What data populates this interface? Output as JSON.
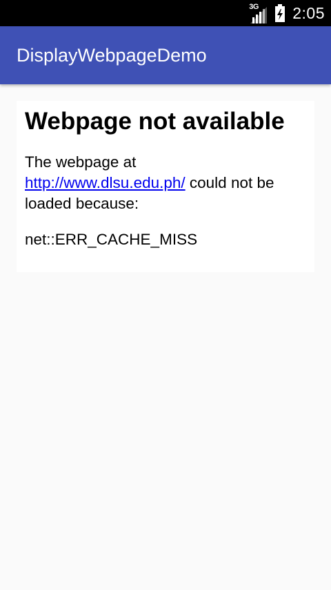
{
  "status_bar": {
    "network_type": "3G",
    "time": "2:05",
    "icons": [
      "signal-icon",
      "battery-icon"
    ]
  },
  "app_bar": {
    "title": "DisplayWebpageDemo",
    "color": "#3f51b5"
  },
  "webview": {
    "error_title": "Webpage not available",
    "message_prefix": "The webpage at",
    "url": "http://www.dlsu.edu.ph/",
    "message_suffix": "could not be loaded because:",
    "error_code": "net::ERR_CACHE_MISS"
  }
}
